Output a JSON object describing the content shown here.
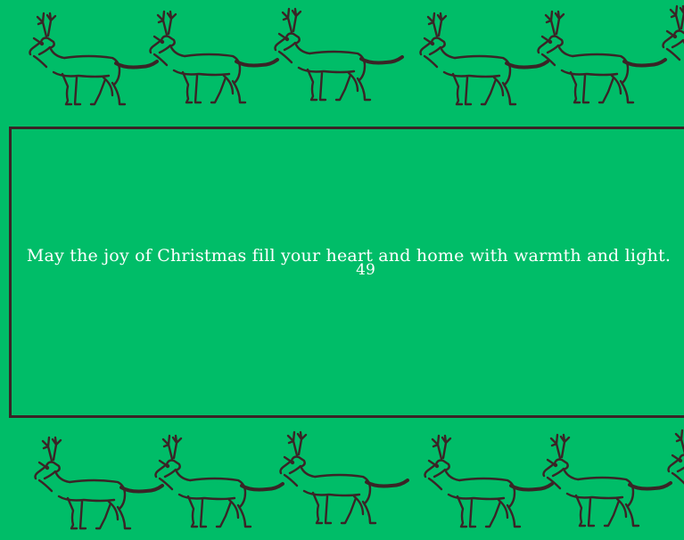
{
  "card": {
    "message": "May the joy of Christmas fill your heart and home with warmth and light.",
    "number": "49"
  },
  "colors": {
    "background": "#00bd68",
    "ink": "#3a2426",
    "text": "#ffffff"
  },
  "decoration": {
    "icon": "reindeer-icon",
    "count_per_row": 6
  }
}
